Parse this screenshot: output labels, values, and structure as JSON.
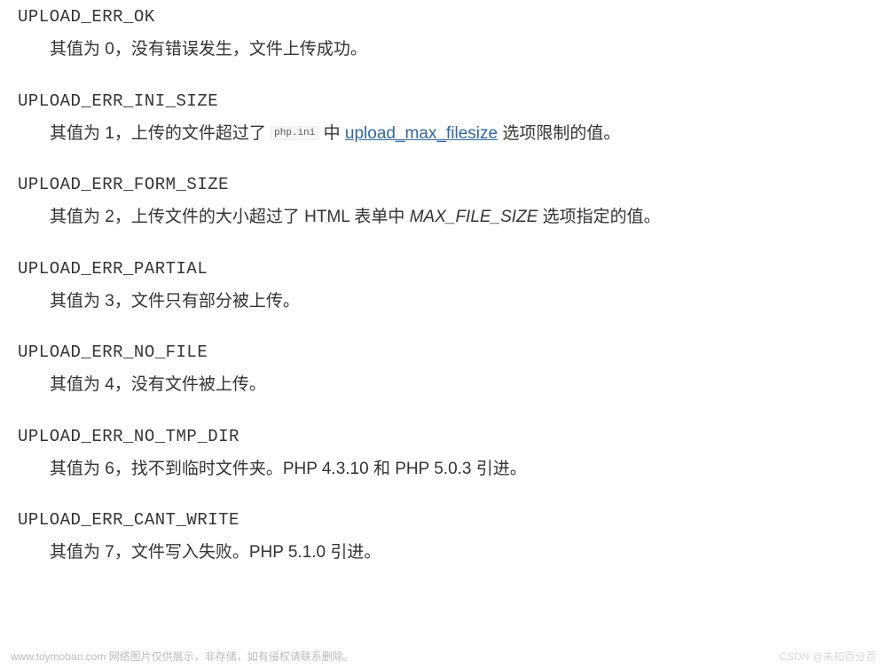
{
  "entries": [
    {
      "name": "UPLOAD_ERR_OK",
      "desc_segments": [
        {
          "type": "text",
          "value": "其值为 0，没有错误发生，文件上传成功。"
        }
      ]
    },
    {
      "name": "UPLOAD_ERR_INI_SIZE",
      "desc_segments": [
        {
          "type": "text",
          "value": "其值为 1，上传的文件超过了 "
        },
        {
          "type": "code",
          "value": "php.ini"
        },
        {
          "type": "text",
          "value": " 中 "
        },
        {
          "type": "link",
          "value": "upload_max_filesize"
        },
        {
          "type": "text",
          "value": " 选项限制的值。"
        }
      ]
    },
    {
      "name": "UPLOAD_ERR_FORM_SIZE",
      "desc_segments": [
        {
          "type": "text",
          "value": "其值为 2，上传文件的大小超过了 HTML 表单中 "
        },
        {
          "type": "italic",
          "value": "MAX_FILE_SIZE"
        },
        {
          "type": "text",
          "value": " 选项指定的值。"
        }
      ]
    },
    {
      "name": "UPLOAD_ERR_PARTIAL",
      "desc_segments": [
        {
          "type": "text",
          "value": "其值为 3，文件只有部分被上传。"
        }
      ]
    },
    {
      "name": "UPLOAD_ERR_NO_FILE",
      "desc_segments": [
        {
          "type": "text",
          "value": "其值为 4，没有文件被上传。"
        }
      ]
    },
    {
      "name": "UPLOAD_ERR_NO_TMP_DIR",
      "desc_segments": [
        {
          "type": "text",
          "value": "其值为 6，找不到临时文件夹。PHP 4.3.10 和 PHP 5.0.3 引进。"
        }
      ]
    },
    {
      "name": "UPLOAD_ERR_CANT_WRITE",
      "desc_segments": [
        {
          "type": "text",
          "value": "其值为 7，文件写入失败。PHP 5.1.0 引进。"
        }
      ]
    }
  ],
  "footer_left": "www.toymoban.com 网络图片仅供展示，非存储，如有侵权请联系删除。",
  "footer_right": "CSDN @未知百分百"
}
